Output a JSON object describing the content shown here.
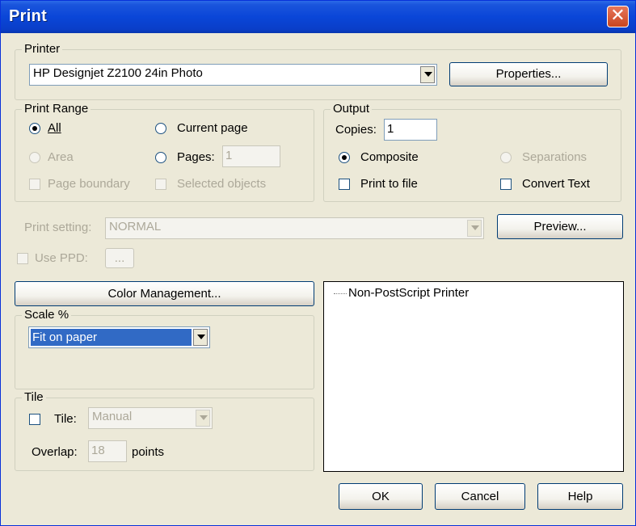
{
  "window": {
    "title": "Print",
    "close_glyph": "✕"
  },
  "printer": {
    "legend": "Printer",
    "selected": "HP Designjet Z2100 24in Photo",
    "properties_label": "Properties..."
  },
  "print_range": {
    "legend": "Print Range",
    "all": "All",
    "current_page": "Current  page",
    "area": "Area",
    "pages": "Pages:",
    "pages_value": "1",
    "page_boundary": "Page boundary",
    "selected_objects": "Selected objects"
  },
  "output": {
    "legend": "Output",
    "copies_label": "Copies:",
    "copies_value": "1",
    "composite": "Composite",
    "separations": "Separations",
    "print_to_file": "Print to file",
    "convert_text": "Convert Text"
  },
  "print_setting": {
    "label": "Print setting:",
    "value": "NORMAL",
    "preview_label": "Preview..."
  },
  "use_ppd": {
    "label": "Use PPD:",
    "button": "..."
  },
  "color_management": {
    "label": "Color Management..."
  },
  "scale": {
    "legend": "Scale %",
    "value": "Fit on paper"
  },
  "tile": {
    "legend": "Tile",
    "tile_label": "Tile:",
    "tile_value": "Manual",
    "overlap_label": "Overlap:",
    "overlap_value": "18",
    "points": "points"
  },
  "info_list": {
    "items": [
      "Non-PostScript Printer"
    ]
  },
  "buttons": {
    "ok": "OK",
    "cancel": "Cancel",
    "help": "Help"
  },
  "colors": {
    "title_bar": "#0A46D8",
    "dialog_bg": "#ECE9D8",
    "selection": "#316AC5"
  }
}
